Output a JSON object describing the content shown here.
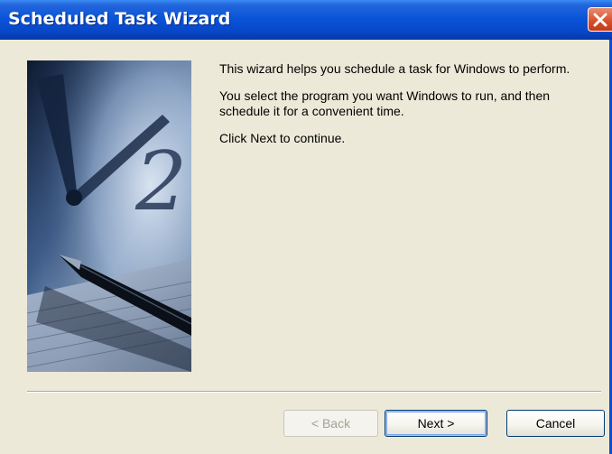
{
  "window": {
    "title": "Scheduled Task Wizard",
    "close_icon": "close-icon"
  },
  "image": {
    "icon": "clock-and-pen-illustration"
  },
  "content": {
    "paragraph1": "This wizard helps you schedule a task for Windows to perform.",
    "paragraph2": "You select the program you want Windows to run, and then schedule it for a convenient time.",
    "paragraph3": "Click Next to continue."
  },
  "buttons": {
    "back": "< Back",
    "next": "Next >",
    "cancel": "Cancel"
  },
  "colors": {
    "titlebar": "#0A55D8",
    "dialog_bg": "#ECE9D8",
    "close_button": "#D8522E",
    "default_button_ring": "#7CA3E6"
  }
}
